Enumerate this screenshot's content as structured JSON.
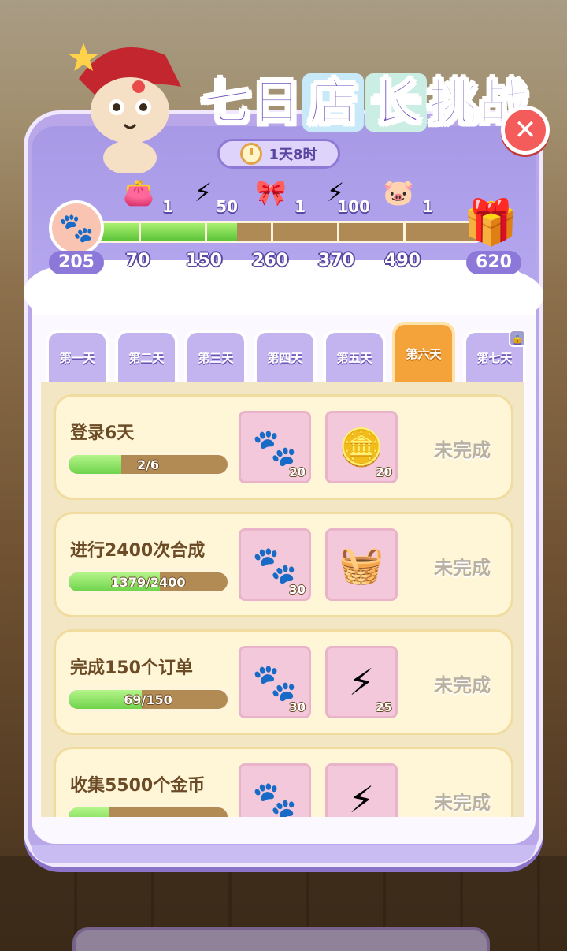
{
  "title": {
    "chars": [
      "七",
      "日",
      "店",
      "长",
      "挑",
      "战"
    ]
  },
  "timer": {
    "label": "1天8时"
  },
  "milestone_rewards": [
    {
      "icon": "wallet-icon",
      "glyph": "👛",
      "count": "1"
    },
    {
      "icon": "energy-check-icon",
      "glyph": "⚡",
      "count": "50"
    },
    {
      "icon": "clothing-icon",
      "glyph": "🎀",
      "count": "1"
    },
    {
      "icon": "lightning-icon",
      "glyph": "⚡",
      "count": "100"
    },
    {
      "icon": "pig-box-icon",
      "glyph": "🐷",
      "count": "1"
    }
  ],
  "progress": {
    "current_label": "205",
    "ticks": [
      "70",
      "150",
      "260",
      "370",
      "490"
    ],
    "final_label": "620",
    "filled_fraction": 0.38
  },
  "tabs": [
    {
      "label": "第一天",
      "active": false,
      "locked": false
    },
    {
      "label": "第二天",
      "active": false,
      "locked": false
    },
    {
      "label": "第三天",
      "active": false,
      "locked": false
    },
    {
      "label": "第四天",
      "active": false,
      "locked": false
    },
    {
      "label": "第五天",
      "active": false,
      "locked": false
    },
    {
      "label": "第六天",
      "active": true,
      "locked": false
    },
    {
      "label": "第七天",
      "active": false,
      "locked": true
    }
  ],
  "tasks": [
    {
      "title": "登录6天",
      "progress_text": "2/6",
      "progress_fraction": 0.333,
      "rewards": [
        {
          "icon": "paw-icon",
          "glyph": "🐾",
          "count": "20"
        },
        {
          "icon": "coin-icon",
          "glyph": "🪙",
          "count": "20"
        }
      ],
      "status": "未完成"
    },
    {
      "title": "进行2400次合成",
      "progress_text": "1379/2400",
      "progress_fraction": 0.575,
      "rewards": [
        {
          "icon": "paw-icon",
          "glyph": "🐾",
          "count": "30"
        },
        {
          "icon": "basket-icon",
          "glyph": "🧺",
          "count": ""
        }
      ],
      "status": "未完成"
    },
    {
      "title": "完成150个订单",
      "progress_text": "69/150",
      "progress_fraction": 0.46,
      "rewards": [
        {
          "icon": "paw-icon",
          "glyph": "🐾",
          "count": "30"
        },
        {
          "icon": "lightning-icon",
          "glyph": "⚡",
          "count": "25"
        }
      ],
      "status": "未完成"
    },
    {
      "title": "收集5500个金币",
      "progress_text": "",
      "progress_fraction": 0.25,
      "rewards": [
        {
          "icon": "paw-icon",
          "glyph": "🐾",
          "count": ""
        },
        {
          "icon": "lightning-icon",
          "glyph": "⚡",
          "count": ""
        }
      ],
      "status": "未完成"
    }
  ]
}
